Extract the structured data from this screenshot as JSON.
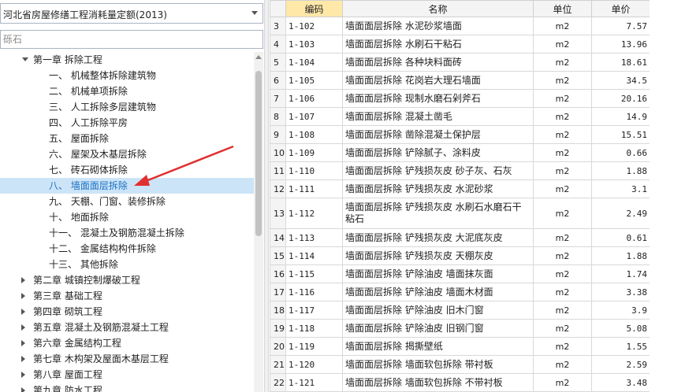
{
  "dropdown": {
    "selected": "河北省房屋修缮工程消耗量定额(2013)"
  },
  "search": {
    "placeholder": "砾石"
  },
  "tree": [
    {
      "label": "第一章 拆除工程",
      "level": 0,
      "state": "open"
    },
    {
      "label": "一、 机械整体拆除建筑物",
      "level": 1
    },
    {
      "label": "二、 机械单项拆除",
      "level": 1
    },
    {
      "label": "三、 人工拆除多层建筑物",
      "level": 1
    },
    {
      "label": "四、 人工拆除平房",
      "level": 1
    },
    {
      "label": "五、 屋面拆除",
      "level": 1
    },
    {
      "label": "六、 屋架及木基层拆除",
      "level": 1
    },
    {
      "label": "七、 砖石砌体拆除",
      "level": 1
    },
    {
      "label": "八、 墙面面层拆除",
      "level": 1,
      "selected": true
    },
    {
      "label": "九、 天棚、门窗、装修拆除",
      "level": 1
    },
    {
      "label": "十、 地面拆除",
      "level": 1
    },
    {
      "label": "十一、 混凝土及钢筋混凝土拆除",
      "level": 1
    },
    {
      "label": "十二、 金属结构构件拆除",
      "level": 1
    },
    {
      "label": "十三、 其他拆除",
      "level": 1
    },
    {
      "label": "第二章 城镇控制爆破工程",
      "level": 0,
      "state": "closed"
    },
    {
      "label": "第三章 基础工程",
      "level": 0,
      "state": "closed"
    },
    {
      "label": "第四章 砌筑工程",
      "level": 0,
      "state": "closed"
    },
    {
      "label": "第五章 混凝土及钢筋混凝土工程",
      "level": 0,
      "state": "closed"
    },
    {
      "label": "第六章 金属结构工程",
      "level": 0,
      "state": "closed"
    },
    {
      "label": "第七章 木构架及屋面木基层工程",
      "level": 0,
      "state": "closed"
    },
    {
      "label": "第八章 屋面工程",
      "level": 0,
      "state": "closed"
    },
    {
      "label": "第九章 防水工程",
      "level": 0,
      "state": "closed"
    }
  ],
  "table": {
    "headers": {
      "code": "编码",
      "name": "名称",
      "unit": "单位",
      "price": "单价"
    },
    "rows": [
      {
        "idx": "3",
        "code": "1-102",
        "name": "墙面面层拆除 水泥砂浆墙面",
        "unit": "m2",
        "price": "7.57"
      },
      {
        "idx": "4",
        "code": "1-103",
        "name": "墙面面层拆除 水刷石干粘石",
        "unit": "m2",
        "price": "13.96"
      },
      {
        "idx": "5",
        "code": "1-104",
        "name": "墙面面层拆除 各种块料面砖",
        "unit": "m2",
        "price": "18.61"
      },
      {
        "idx": "6",
        "code": "1-105",
        "name": "墙面面层拆除 花岗岩大理石墙面",
        "unit": "m2",
        "price": "34.5"
      },
      {
        "idx": "7",
        "code": "1-106",
        "name": "墙面面层拆除 现制水磨石剁斧石",
        "unit": "m2",
        "price": "20.16"
      },
      {
        "idx": "8",
        "code": "1-107",
        "name": "墙面面层拆除 混凝土凿毛",
        "unit": "m2",
        "price": "14.9"
      },
      {
        "idx": "9",
        "code": "1-108",
        "name": "墙面面层拆除 凿除混凝土保护层",
        "unit": "m2",
        "price": "15.51"
      },
      {
        "idx": "10",
        "code": "1-109",
        "name": "墙面面层拆除 铲除腻子、涂料皮",
        "unit": "m2",
        "price": "0.66"
      },
      {
        "idx": "11",
        "code": "1-110",
        "name": "墙面面层拆除 铲残损灰皮 砂子灰、石灰",
        "unit": "m2",
        "price": "1.88"
      },
      {
        "idx": "12",
        "code": "1-111",
        "name": "墙面面层拆除 铲残损灰皮 水泥砂浆",
        "unit": "m2",
        "price": "3.1"
      },
      {
        "idx": "13",
        "code": "1-112",
        "name": "墙面面层拆除 铲残损灰皮 水刷石水磨石干粘石",
        "unit": "m2",
        "price": "2.49"
      },
      {
        "idx": "14",
        "code": "1-113",
        "name": "墙面面层拆除 铲残损灰皮 大泥底灰皮",
        "unit": "m2",
        "price": "0.61"
      },
      {
        "idx": "15",
        "code": "1-114",
        "name": "墙面面层拆除 铲残损灰皮 天棚灰皮",
        "unit": "m2",
        "price": "1.88"
      },
      {
        "idx": "16",
        "code": "1-115",
        "name": "墙面面层拆除 铲除油皮 墙面抹灰面",
        "unit": "m2",
        "price": "1.74"
      },
      {
        "idx": "17",
        "code": "1-116",
        "name": "墙面面层拆除 铲除油皮 墙面木材面",
        "unit": "m2",
        "price": "3.38"
      },
      {
        "idx": "18",
        "code": "1-117",
        "name": "墙面面层拆除 铲除油皮 旧木门窗",
        "unit": "m2",
        "price": "3.9"
      },
      {
        "idx": "19",
        "code": "1-118",
        "name": "墙面面层拆除 铲除油皮 旧钢门窗",
        "unit": "m2",
        "price": "5.08"
      },
      {
        "idx": "20",
        "code": "1-119",
        "name": "墙面面层拆除 揭撕壁纸",
        "unit": "m2",
        "price": "1.55"
      },
      {
        "idx": "21",
        "code": "1-120",
        "name": "墙面面层拆除 墙面软包拆除 带衬板",
        "unit": "m2",
        "price": "2.59"
      },
      {
        "idx": "22",
        "code": "1-121",
        "name": "墙面面层拆除 墙面软包拆除 不带衬板",
        "unit": "m2",
        "price": "3.48"
      }
    ]
  },
  "colors": {
    "selection_bg": "#cce4f7",
    "selection_text": "#1a6fc4",
    "code_header_bg": "#ffe8a8",
    "annotation_arrow": "#e03030"
  },
  "icons": {
    "expanded": "triangle-down-icon",
    "collapsed": "triangle-right-icon",
    "dropdown": "chevron-down-icon"
  }
}
